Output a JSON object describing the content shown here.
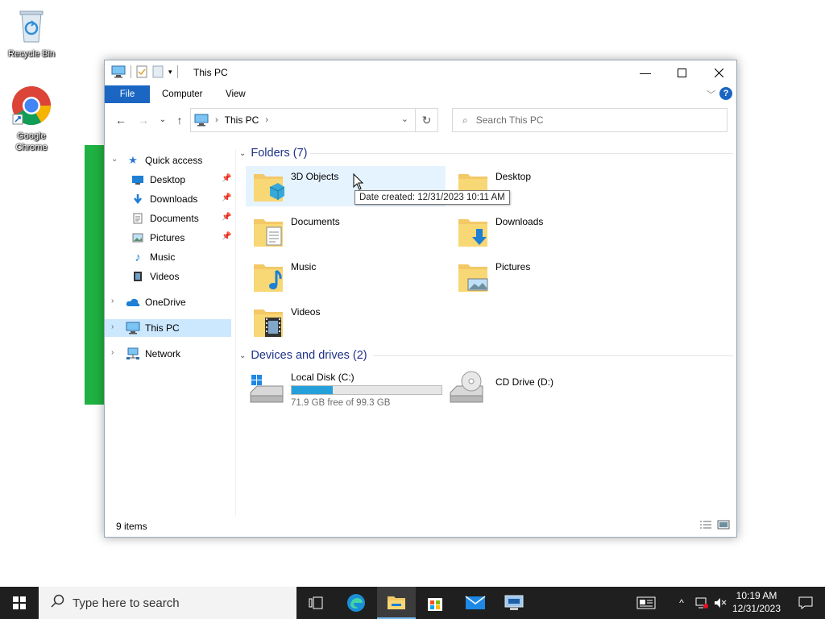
{
  "desktop": {
    "icons": [
      {
        "label": "Recycle Bin"
      },
      {
        "label": "Google Chrome"
      }
    ]
  },
  "window": {
    "title": "This PC",
    "ribbon_tabs": {
      "file": "File",
      "computer": "Computer",
      "view": "View"
    },
    "help_label": "?",
    "address": {
      "crumb": "This PC"
    },
    "search": {
      "placeholder": "Search This PC"
    },
    "sidebar": {
      "quick_access": "Quick access",
      "desktop": "Desktop",
      "downloads": "Downloads",
      "documents": "Documents",
      "pictures": "Pictures",
      "music": "Music",
      "videos": "Videos",
      "onedrive": "OneDrive",
      "this_pc": "This PC",
      "network": "Network"
    },
    "content": {
      "folders_header": "Folders (7)",
      "folders": [
        {
          "name": "3D Objects",
          "icon": "3d-objects-folder-icon"
        },
        {
          "name": "Desktop",
          "icon": "desktop-folder-icon"
        },
        {
          "name": "Documents",
          "icon": "documents-folder-icon"
        },
        {
          "name": "Downloads",
          "icon": "downloads-folder-icon"
        },
        {
          "name": "Music",
          "icon": "music-folder-icon"
        },
        {
          "name": "Pictures",
          "icon": "pictures-folder-icon"
        },
        {
          "name": "Videos",
          "icon": "videos-folder-icon"
        }
      ],
      "devices_header": "Devices and drives (2)",
      "drives": [
        {
          "name": "Local Disk (C:)",
          "free_text": "71.9 GB free of 99.3 GB",
          "used_fraction": 0.276
        },
        {
          "name": "CD Drive (D:)"
        }
      ],
      "tooltip": "Date created: 12/31/2023 10:11 AM"
    },
    "status": {
      "item_count": "9 items"
    }
  },
  "taskbar": {
    "search_placeholder": "Type here to search",
    "time": "10:19 AM",
    "date": "12/31/2023"
  },
  "colors": {
    "accent": "#1a66c2",
    "selection": "#cce8ff",
    "hover": "#e5f3ff",
    "drive_bar": "#26a0da",
    "group_header": "#1e3287",
    "taskbar": "#1f1f1f",
    "desktop_green_bar": "#1fb141"
  }
}
